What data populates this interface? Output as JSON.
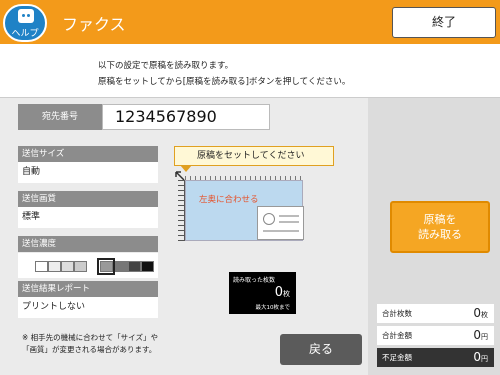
{
  "header": {
    "help_label": "ヘルプ",
    "title": "ファクス",
    "end_label": "終了",
    "accent": "#f39a1a"
  },
  "instruction": {
    "line1": "以下の設定で原稿を読み取ります。",
    "line2": "原稿をセットしてから[原稿を読み取る]ボタンを押してください。"
  },
  "destination": {
    "label": "宛先番号",
    "value": "1234567890"
  },
  "settings": {
    "size": {
      "label": "送信サイズ",
      "value": "自動"
    },
    "quality": {
      "label": "送信画質",
      "value": "標準"
    },
    "density": {
      "label": "送信濃度",
      "levels": 9,
      "selected": 5
    },
    "report": {
      "label": "送信結果レポート",
      "value": "プリントしない"
    }
  },
  "note": {
    "line1": "※ 相手先の機械に合わせて「サイズ」や",
    "line2": "「画質」が変更される場合があります。"
  },
  "preview": {
    "balloon": "原稿をセットしてください",
    "align_text": "左奥に合わせる",
    "arrow_icon": "corner-arrow-icon"
  },
  "scan_counter": {
    "title": "読み取った枚数",
    "count": "0",
    "unit": "枚",
    "max": "最大10枚まで"
  },
  "buttons": {
    "back": "戻る",
    "scan_line1": "原稿を",
    "scan_line2": "読み取る"
  },
  "summary": [
    {
      "label": "合計枚数",
      "value": "0",
      "unit": "枚"
    },
    {
      "label": "合計金額",
      "value": "0",
      "unit": "円"
    },
    {
      "label": "不足金額",
      "value": "0",
      "unit": "円"
    }
  ]
}
